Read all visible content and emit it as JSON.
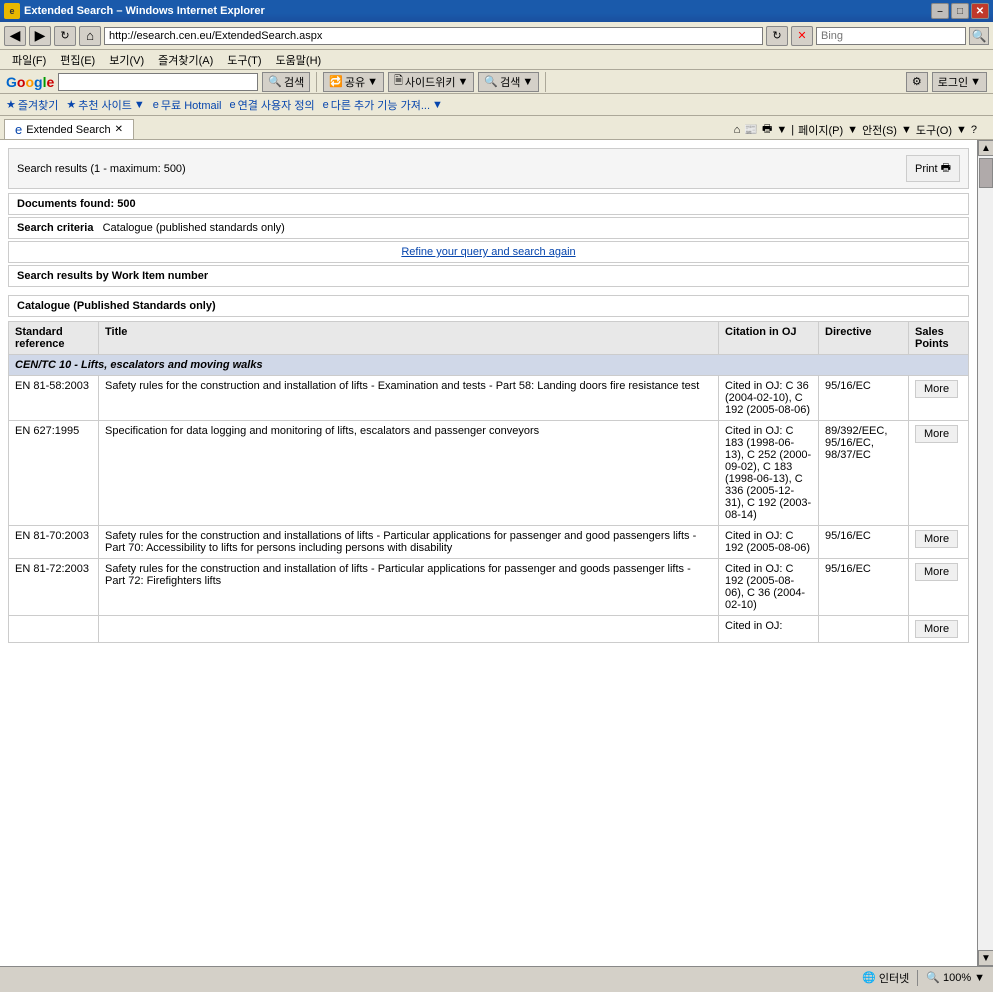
{
  "window": {
    "title": "Extended Search – Windows Internet Explorer",
    "icon": "IE"
  },
  "address_bar": {
    "url": "http://esearch.cen.eu/ExtendedSearch.aspx",
    "search_placeholder": "Bing"
  },
  "menus": [
    "파일(F)",
    "편집(E)",
    "보기(V)",
    "즐겨찾기(A)",
    "도구(T)",
    "도움말(H)"
  ],
  "google_bar": {
    "search_input": "",
    "buttons": [
      "검색",
      "공유",
      "사이드위키",
      "검색",
      "로그인"
    ],
    "logo": "Google"
  },
  "favorites_bar": {
    "items": [
      "즐겨찾기",
      "추천 사이트",
      "무료 Hotmail",
      "연결 사용자 정의",
      "다른 추가 기능 가져..."
    ]
  },
  "tab": {
    "label": "Extended Search",
    "new_tab_label": "+"
  },
  "tab_toolbar": {
    "page_label": "페이지(P)",
    "safety_label": "안전(S)",
    "tools_label": "도구(O)",
    "help_label": "?"
  },
  "results": {
    "header": "Search results (1 - maximum: 500)",
    "print_label": "Print",
    "docs_found": "Documents found: 500",
    "search_criteria_label": "Search criteria",
    "search_criteria_value": "Catalogue (published standards only)",
    "refine_link": "Refine your query and search again",
    "work_item_label": "Search results by Work Item number",
    "catalogue_label": "Catalogue (Published Standards only)",
    "columns": {
      "ref": "Standard reference",
      "title": "Title",
      "citation": "Citation in OJ",
      "directive": "Directive",
      "sales": "Sales Points"
    },
    "group": "CEN/TC 10 - Lifts, escalators and moving walks",
    "rows": [
      {
        "ref": "EN 81-58:2003",
        "title": "Safety rules for the construction and installation of lifts - Examination and tests - Part 58: Landing doors fire resistance test",
        "citation": "Cited in OJ: C 36 (2004-02-10), C 192 (2005-08-06)",
        "directive": "95/16/EC",
        "more": "More"
      },
      {
        "ref": "EN 627:1995",
        "title": "Specification for data logging and monitoring of lifts, escalators and passenger conveyors",
        "citation": "Cited in OJ: C 183 (1998-06-13), C 252 (2000-09-02), C 183 (1998-06-13), C 336 (2005-12-31), C 192 (2003-08-14)",
        "directive": "89/392/EEC, 95/16/EC, 98/37/EC",
        "more": "More"
      },
      {
        "ref": "EN 81-70:2003",
        "title": "Safety rules for the construction and installations of lifts - Particular applications for passenger and good passengers lifts - Part 70: Accessibility to lifts for persons including persons with disability",
        "citation": "Cited in OJ: C 192 (2005-08-06)",
        "directive": "95/16/EC",
        "more": "More"
      },
      {
        "ref": "EN 81-72:2003",
        "title": "Safety rules for the construction and installation of lifts - Particular applications for passenger and goods passenger lifts - Part 72: Firefighters lifts",
        "citation": "Cited in OJ: C 192 (2005-08-06), C 36 (2004-02-10)",
        "directive": "95/16/EC",
        "more": "More"
      },
      {
        "ref": "",
        "title": "",
        "citation": "Cited in OJ:",
        "directive": "",
        "more": "More",
        "partial": true
      }
    ]
  },
  "status_bar": {
    "internet_label": "인터넷",
    "zoom_label": "100%"
  }
}
